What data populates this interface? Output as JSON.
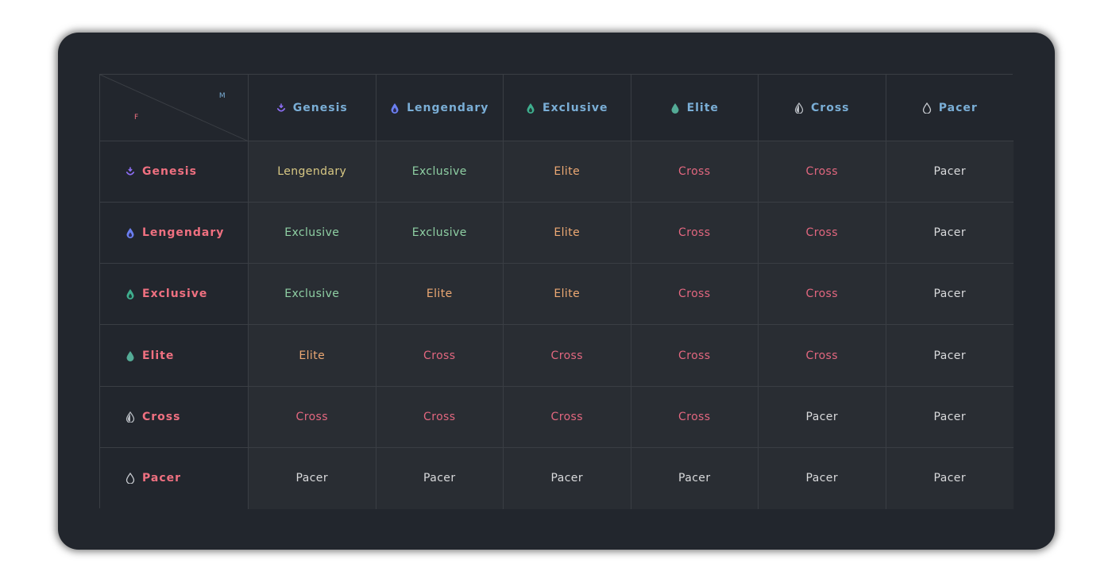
{
  "axis": {
    "male_label": "M",
    "female_label": "F"
  },
  "colors": {
    "lengendary": "#d8c884",
    "exclusive": "#8fd0a4",
    "elite": "#eca873",
    "cross": "#e2677f",
    "pacer": "#d9dadc"
  },
  "columns": [
    {
      "label": "Genesis",
      "icon": "genesis-icon"
    },
    {
      "label": "Lengendary",
      "icon": "lengendary-drop-icon"
    },
    {
      "label": "Exclusive",
      "icon": "exclusive-drop-icon"
    },
    {
      "label": "Elite",
      "icon": "elite-drop-icon"
    },
    {
      "label": "Cross",
      "icon": "cross-drop-icon"
    },
    {
      "label": "Pacer",
      "icon": "pacer-drop-icon"
    }
  ],
  "rows": [
    {
      "label": "Genesis",
      "icon": "genesis-icon",
      "cells": [
        "Lengendary",
        "Exclusive",
        "Elite",
        "Cross",
        "Cross",
        "Pacer"
      ]
    },
    {
      "label": "Lengendary",
      "icon": "lengendary-drop-icon",
      "cells": [
        "Exclusive",
        "Exclusive",
        "Elite",
        "Cross",
        "Cross",
        "Pacer"
      ]
    },
    {
      "label": "Exclusive",
      "icon": "exclusive-drop-icon",
      "cells": [
        "Exclusive",
        "Elite",
        "Elite",
        "Cross",
        "Cross",
        "Pacer"
      ]
    },
    {
      "label": "Elite",
      "icon": "elite-drop-icon",
      "cells": [
        "Elite",
        "Cross",
        "Cross",
        "Cross",
        "Cross",
        "Pacer"
      ]
    },
    {
      "label": "Cross",
      "icon": "cross-drop-icon",
      "cells": [
        "Cross",
        "Cross",
        "Cross",
        "Cross",
        "Pacer",
        "Pacer"
      ]
    },
    {
      "label": "Pacer",
      "icon": "pacer-drop-icon",
      "cells": [
        "Pacer",
        "Pacer",
        "Pacer",
        "Pacer",
        "Pacer",
        "Pacer"
      ]
    }
  ]
}
